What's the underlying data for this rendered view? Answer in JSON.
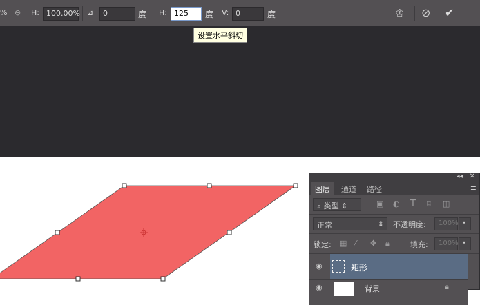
{
  "toolbar": {
    "width_suffix": "%",
    "link_icon": "link-icon",
    "h_label": "H:",
    "h_value": "100.00%",
    "angle_value": "0",
    "angle_unit": "度",
    "hskew_label": "H:",
    "hskew_value": "125",
    "hskew_unit": "度",
    "vskew_label": "V:",
    "vskew_value": "0",
    "vskew_unit": "度",
    "tooltip": "设置水平斜切"
  },
  "colors": {
    "shape": "#f26464",
    "toolbar": "#535053",
    "workspace": "#2b2a2e"
  },
  "panel": {
    "tabs": [
      "图层",
      "通道",
      "路径"
    ],
    "filter_label": "类型",
    "blend_mode": "正常",
    "opacity_label": "不透明度:",
    "opacity_value": "100%",
    "lock_label": "锁定:",
    "fill_label": "填充:",
    "fill_value": "100%",
    "layers": [
      {
        "name": "矩形"
      },
      {
        "name": "背景"
      }
    ]
  }
}
